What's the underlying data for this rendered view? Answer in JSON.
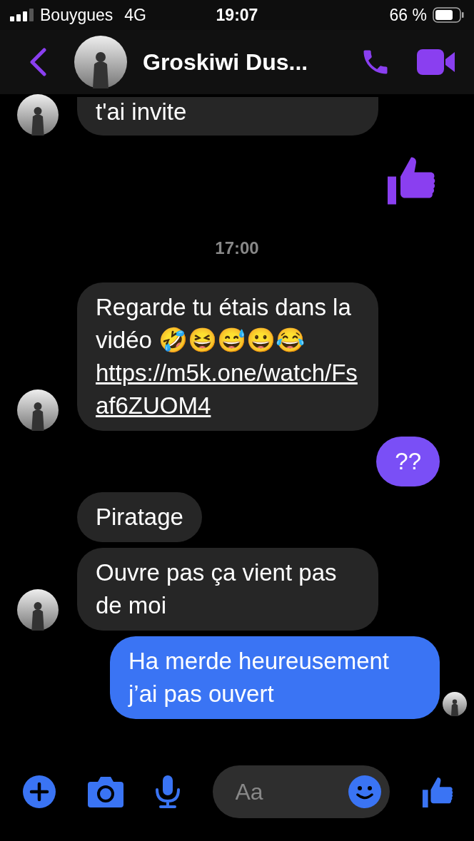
{
  "status_bar": {
    "carrier": "Bouygues",
    "network": "4G",
    "time": "19:07",
    "battery": "66 %"
  },
  "header": {
    "title": "Groskiwi Dus..."
  },
  "messages": [
    {
      "kind": "text",
      "outgoing": false,
      "text": "t'ai invite",
      "avatar": true,
      "cut": true
    },
    {
      "kind": "like",
      "outgoing": true,
      "color": "#8a3ff0"
    },
    {
      "kind": "time",
      "text": "17:00"
    },
    {
      "kind": "text",
      "outgoing": false,
      "text": "Regarde tu étais dans la vidéo 🤣😆😅😀😂",
      "link": "https://m5k.one/watch/Fsaf6ZUOM4",
      "avatar": true,
      "cut": false
    },
    {
      "kind": "text",
      "outgoing": true,
      "text": "??",
      "color": "#7a4ff6",
      "read": false
    },
    {
      "kind": "text",
      "outgoing": false,
      "text": "Piratage",
      "avatar": false,
      "cut": false
    },
    {
      "kind": "text",
      "outgoing": false,
      "text": "Ouvre pas ça vient pas de moi",
      "avatar": true,
      "cut": false
    },
    {
      "kind": "text",
      "outgoing": true,
      "text": "Ha merde heureusement j’ai pas ouvert",
      "color": "#3a74f4",
      "read": true
    }
  ],
  "composer": {
    "placeholder": "Aa"
  }
}
